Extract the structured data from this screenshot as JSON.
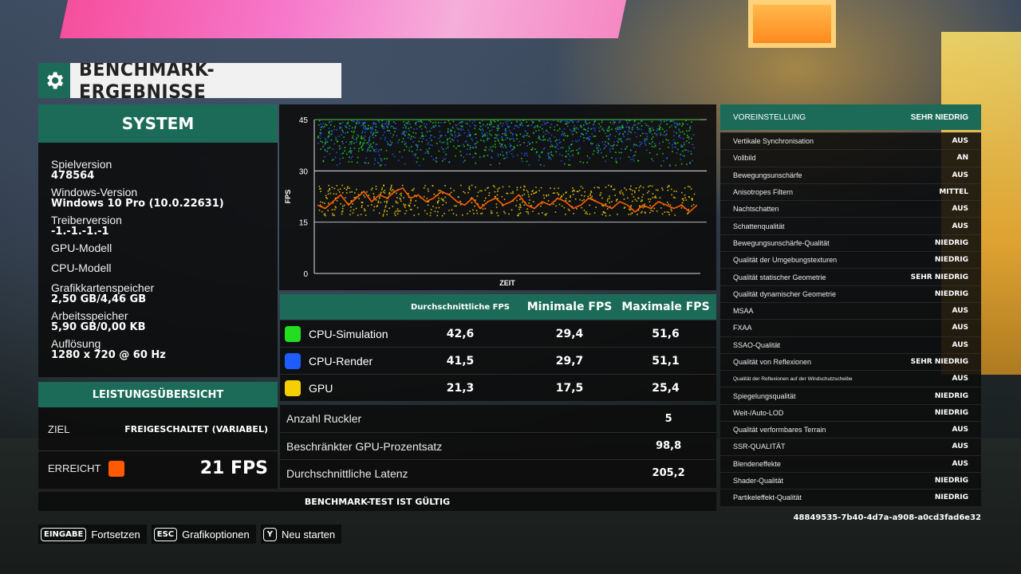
{
  "title": "BENCHMARK-ERGEBNISSE",
  "system": {
    "header": "SYSTEM",
    "items": [
      {
        "label": "Spielversion",
        "value": "478564"
      },
      {
        "label": "Windows-Version",
        "value": "Windows 10 Pro (10.0.22631)"
      },
      {
        "label": "Treiberversion",
        "value": "-1.-1.-1.-1"
      },
      {
        "label": "GPU-Modell",
        "value": ""
      },
      {
        "label": "CPU-Modell",
        "value": ""
      },
      {
        "label": "Grafikkartenspeicher",
        "value": "2,50 GB/4,46 GB"
      },
      {
        "label": "Arbeitsspeicher",
        "value": "5,90 GB/0,00 KB"
      },
      {
        "label": "Auflösung",
        "value": "1280 x 720 @ 60 Hz"
      }
    ]
  },
  "performance": {
    "header": "LEISTUNGSÜBERSICHT",
    "target_label": "ZIEL",
    "target_value": "FREIGESCHALTET (VARIABEL)",
    "achieved_label": "ERREICHT",
    "achieved_value": "21 FPS",
    "achieved_color": "#ff5a00"
  },
  "chart_data": {
    "type": "scatter",
    "xlabel": "ZEIT",
    "ylabel": "FPS",
    "ylim": [
      0,
      45
    ],
    "yticks": [
      0,
      15,
      30,
      45
    ],
    "series": [
      {
        "name": "CPU-Simulation",
        "color": "#22dd22",
        "range": [
          30,
          45
        ]
      },
      {
        "name": "CPU-Render",
        "color": "#1e5cff",
        "range": [
          30,
          45
        ]
      },
      {
        "name": "GPU",
        "color": "#f5d000",
        "range": [
          17,
          26
        ]
      },
      {
        "name": "Durchschnitt",
        "color": "#ff5a00",
        "type": "line",
        "values": [
          20,
          19,
          21,
          23,
          20,
          22,
          24,
          21,
          23,
          22,
          24,
          25,
          22,
          23,
          21,
          22,
          24,
          23,
          21,
          20,
          22,
          19,
          21,
          22,
          20,
          21,
          23,
          20,
          19,
          21,
          20,
          22,
          21,
          19,
          20,
          22,
          21,
          20,
          19,
          21,
          20,
          18,
          20,
          19,
          21,
          20,
          19,
          20,
          18,
          20
        ]
      }
    ]
  },
  "stats": {
    "headers": {
      "avg": "Durchschnittliche FPS",
      "min": "Minimale FPS",
      "max": "Maximale FPS"
    },
    "rows": [
      {
        "name": "CPU-Simulation",
        "color": "#22dd22",
        "avg": "42,6",
        "min": "29,4",
        "max": "51,6"
      },
      {
        "name": "CPU-Render",
        "color": "#1e5cff",
        "avg": "41,5",
        "min": "29,7",
        "max": "51,1"
      },
      {
        "name": "GPU",
        "color": "#f5d000",
        "avg": "21,3",
        "min": "17,5",
        "max": "25,4"
      }
    ]
  },
  "misc": [
    {
      "label": "Anzahl Ruckler",
      "value": "5"
    },
    {
      "label": "Beschränkter GPU-Prozentsatz",
      "value": "98,8"
    },
    {
      "label": "Durchschnittliche Latenz",
      "value": "205,2"
    }
  ],
  "valid_text": "BENCHMARK-TEST IST GÜLTIG",
  "settings": {
    "preset_label": "VOREINSTELLUNG",
    "preset_value": "SEHR NIEDRIG",
    "items": [
      {
        "label": "Vertikale Synchronisation",
        "value": "AUS"
      },
      {
        "label": "Vollbild",
        "value": "AN"
      },
      {
        "label": "Bewegungsunschärfe",
        "value": "AUS"
      },
      {
        "label": "Anisotropes Filtern",
        "value": "MITTEL"
      },
      {
        "label": "Nachtschatten",
        "value": "AUS"
      },
      {
        "label": "Schattenqualität",
        "value": "AUS"
      },
      {
        "label": "Bewegungsunschärfe-Qualität",
        "value": "NIEDRIG"
      },
      {
        "label": "Qualität der Umgebungstexturen",
        "value": "NIEDRIG"
      },
      {
        "label": "Qualität statischer Geometrie",
        "value": "SEHR NIEDRIG"
      },
      {
        "label": "Qualität dynamischer Geometrie",
        "value": "NIEDRIG"
      },
      {
        "label": "MSAA",
        "value": "AUS"
      },
      {
        "label": "FXAA",
        "value": "AUS"
      },
      {
        "label": "SSAO-Qualität",
        "value": "AUS"
      },
      {
        "label": "Qualität von Reflexionen",
        "value": "SEHR NIEDRIG"
      },
      {
        "label": "Qualität der Reflexionen auf der Windschutzscheibe",
        "value": "AUS"
      },
      {
        "label": "Spiegelungsqualität",
        "value": "NIEDRIG"
      },
      {
        "label": "Weit-/Auto-LOD",
        "value": "NIEDRIG"
      },
      {
        "label": "Qualität verformbares Terrain",
        "value": "AUS"
      },
      {
        "label": "SSR-QUALITÄT",
        "value": "AUS"
      },
      {
        "label": "Blendeneffekte",
        "value": "AUS"
      },
      {
        "label": "Shader-Qualität",
        "value": "NIEDRIG"
      },
      {
        "label": "Partikeleffekt-Qualität",
        "value": "NIEDRIG"
      }
    ]
  },
  "hash": "48849535-7b40-4d7a-a908-a0cd3fad6e32",
  "hints": [
    {
      "key": "EINGABE",
      "label": "Fortsetzen"
    },
    {
      "key": "ESC",
      "label": "Grafikoptionen"
    },
    {
      "key": "Y",
      "label": "Neu starten"
    }
  ]
}
